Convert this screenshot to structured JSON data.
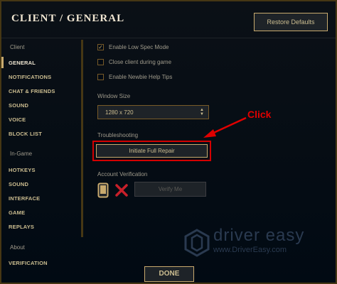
{
  "header": {
    "title": "CLIENT / GENERAL",
    "restore_label": "Restore Defaults"
  },
  "sidebar": {
    "client_section": "Client",
    "client_items": [
      {
        "label": "GENERAL",
        "active": true
      },
      {
        "label": "NOTIFICATIONS"
      },
      {
        "label": "CHAT & FRIENDS"
      },
      {
        "label": "SOUND"
      },
      {
        "label": "VOICE"
      },
      {
        "label": "BLOCK LIST"
      }
    ],
    "ingame_section": "In-Game",
    "ingame_items": [
      {
        "label": "HOTKEYS"
      },
      {
        "label": "SOUND"
      },
      {
        "label": "INTERFACE"
      },
      {
        "label": "GAME"
      },
      {
        "label": "REPLAYS"
      }
    ],
    "about_section": "About",
    "about_items": [
      {
        "label": "VERIFICATION"
      }
    ]
  },
  "options": [
    {
      "label": "Enable Low Spec Mode",
      "checked": true
    },
    {
      "label": "Close client during game",
      "checked": false
    },
    {
      "label": "Enable Newbie Help Tips",
      "checked": false
    }
  ],
  "window_size": {
    "label": "Window Size",
    "value": "1280 x 720"
  },
  "troubleshooting": {
    "label": "Troubleshooting",
    "button_label": "Initiate Full Repair"
  },
  "account_verification": {
    "label": "Account Verification",
    "button_label": "Verify Me"
  },
  "annotation": {
    "text": "Click",
    "color": "#e00000"
  },
  "watermark": {
    "title": "driver easy",
    "url": "www.DriverEasy.com"
  },
  "footer": {
    "done_label": "DONE"
  },
  "colors": {
    "gold": "#c8aa6e",
    "background": "#010a13",
    "text": "#a09b8c",
    "highlight_red": "#d40000"
  }
}
